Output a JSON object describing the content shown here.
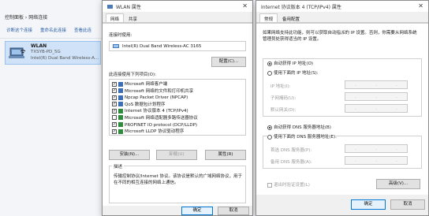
{
  "background": {
    "breadcrumb": "控制面板 › 网络连接",
    "commands": [
      "诊断这个连接",
      "重命名此连接",
      "查看此连"
    ],
    "adapter": {
      "name": "WLAN",
      "ssid": "TXSYB-PD_5G",
      "device": "Intel(R) Dual Band Wireless-A..."
    }
  },
  "wlan_dialog": {
    "title": "WLAN 属性",
    "tabs": [
      "网络",
      "共享"
    ],
    "connect_using_label": "连接时使用:",
    "adapter_name": "Intel(R) Dual Band Wireless-AC 3165",
    "configure_button": "配置(C)...",
    "items_label": "此连接使用下列项目(O):",
    "items": [
      {
        "label": "Microsoft 网络客户端",
        "checked": true,
        "icon": "network-client-icon"
      },
      {
        "label": "Microsoft 网络的文件和打印机共享",
        "checked": true,
        "icon": "file-share-icon"
      },
      {
        "label": "Npcap Packet Driver (NPCAP)",
        "checked": true,
        "icon": "driver-icon"
      },
      {
        "label": "QoS 数据包计划程序",
        "checked": true,
        "icon": "qos-icon"
      },
      {
        "label": "Internet 协议版本 4 (TCP/IPv4)",
        "checked": true,
        "icon": "protocol-icon"
      },
      {
        "label": "Microsoft 网络适配器多路传送器协议",
        "checked": false,
        "icon": "protocol-icon"
      },
      {
        "label": "PROFINET IO protocol (DCP/LLDP)",
        "checked": true,
        "icon": "protocol-icon"
      },
      {
        "label": "Microsoft LLDP 协议驱动程序",
        "checked": true,
        "icon": "protocol-icon"
      }
    ],
    "install_button": "安装(N)...",
    "uninstall_button": "卸载(U)",
    "properties_button": "属性(R)",
    "description_label": "描述",
    "description_text": "传输控制协议/Internet 协议。该协议是默认的广域网络协议，用于在不同的相互连接的网络上通信。",
    "ok_button": "确定",
    "cancel_button": "取消"
  },
  "ipv4_dialog": {
    "title": "Internet 协议版本 4 (TCP/IPv4) 属性",
    "tabs": [
      "常规",
      "备用配置"
    ],
    "intro": "如果网络支持此功能，则可以获取自动指派的 IP 设置。否则，你需要从网络系统管理员处获得适当的 IP 设置。",
    "auto_ip": "自动获得 IP 地址(O)",
    "manual_ip": "使用下面的 IP 地址(S):",
    "ip_label": "IP 地址(I):",
    "mask_label": "子网掩码(U):",
    "gateway_label": "默认网关(D):",
    "auto_dns": "自动获得 DNS 服务器地址(B)",
    "manual_dns": "使用下面的 DNS 服务器地址(E):",
    "dns1_label": "首选 DNS 服务器(P):",
    "dns2_label": "备用 DNS 服务器(A):",
    "validate_label": "退出时验证设置(L)",
    "advanced_button": "高级(V)...",
    "ok_button": "确定",
    "cancel_button": "取消"
  }
}
